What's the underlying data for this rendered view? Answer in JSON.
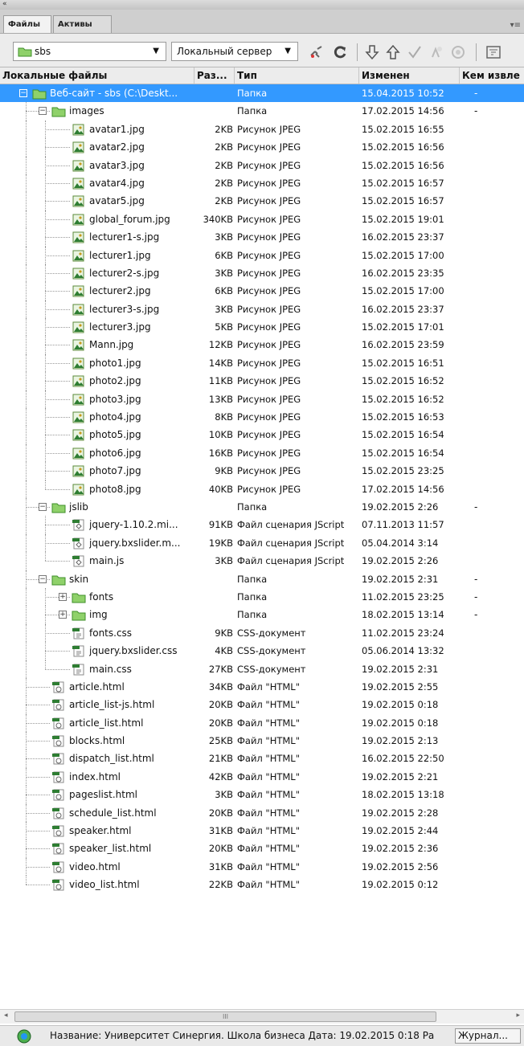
{
  "top": {
    "collapse_glyph": "«",
    "panel_menu_glyph": "▾≡"
  },
  "tabs": [
    {
      "label": "Файлы"
    },
    {
      "label": "Активы"
    }
  ],
  "toolbar": {
    "site_select": "sbs",
    "server_select": "Локальный сервер"
  },
  "icons": {
    "connect": "connect-icon",
    "refresh": "refresh-icon",
    "get": "get-files-icon",
    "put": "put-files-icon",
    "checkout": "check-out-icon",
    "checkin": "check-in-icon",
    "sync": "synchronize-icon",
    "expand": "expand-panel-icon"
  },
  "columns": {
    "name": "Локальные файлы",
    "size": "Раз...",
    "type": "Тип",
    "modified": "Изменен",
    "checked_out": "Кем извле"
  },
  "rows": [
    {
      "depth": 0,
      "kind": "folder",
      "expand": "-",
      "name": "Веб-сайт - sbs (C:\\Deskt...",
      "size": "",
      "type": "Папка",
      "modified": "15.04.2015 10:52",
      "co": "-",
      "selected": true
    },
    {
      "depth": 1,
      "kind": "folder",
      "expand": "-",
      "name": "images",
      "size": "",
      "type": "Папка",
      "modified": "17.02.2015 14:56",
      "co": "-"
    },
    {
      "depth": 2,
      "kind": "jpg",
      "name": "avatar1.jpg",
      "size": "2KB",
      "type": "Рисунок JPEG",
      "modified": "15.02.2015 16:55"
    },
    {
      "depth": 2,
      "kind": "jpg",
      "name": "avatar2.jpg",
      "size": "2KB",
      "type": "Рисунок JPEG",
      "modified": "15.02.2015 16:56"
    },
    {
      "depth": 2,
      "kind": "jpg",
      "name": "avatar3.jpg",
      "size": "2KB",
      "type": "Рисунок JPEG",
      "modified": "15.02.2015 16:56"
    },
    {
      "depth": 2,
      "kind": "jpg",
      "name": "avatar4.jpg",
      "size": "2KB",
      "type": "Рисунок JPEG",
      "modified": "15.02.2015 16:57"
    },
    {
      "depth": 2,
      "kind": "jpg",
      "name": "avatar5.jpg",
      "size": "2KB",
      "type": "Рисунок JPEG",
      "modified": "15.02.2015 16:57"
    },
    {
      "depth": 2,
      "kind": "jpg",
      "name": "global_forum.jpg",
      "size": "340KB",
      "type": "Рисунок JPEG",
      "modified": "15.02.2015 19:01"
    },
    {
      "depth": 2,
      "kind": "jpg",
      "name": "lecturer1-s.jpg",
      "size": "3KB",
      "type": "Рисунок JPEG",
      "modified": "16.02.2015 23:37"
    },
    {
      "depth": 2,
      "kind": "jpg",
      "name": "lecturer1.jpg",
      "size": "6KB",
      "type": "Рисунок JPEG",
      "modified": "15.02.2015 17:00"
    },
    {
      "depth": 2,
      "kind": "jpg",
      "name": "lecturer2-s.jpg",
      "size": "3KB",
      "type": "Рисунок JPEG",
      "modified": "16.02.2015 23:35"
    },
    {
      "depth": 2,
      "kind": "jpg",
      "name": "lecturer2.jpg",
      "size": "6KB",
      "type": "Рисунок JPEG",
      "modified": "15.02.2015 17:00"
    },
    {
      "depth": 2,
      "kind": "jpg",
      "name": "lecturer3-s.jpg",
      "size": "3KB",
      "type": "Рисунок JPEG",
      "modified": "16.02.2015 23:37"
    },
    {
      "depth": 2,
      "kind": "jpg",
      "name": "lecturer3.jpg",
      "size": "5KB",
      "type": "Рисунок JPEG",
      "modified": "15.02.2015 17:01"
    },
    {
      "depth": 2,
      "kind": "jpg",
      "name": "Mann.jpg",
      "size": "12KB",
      "type": "Рисунок JPEG",
      "modified": "16.02.2015 23:59"
    },
    {
      "depth": 2,
      "kind": "jpg",
      "name": "photo1.jpg",
      "size": "14KB",
      "type": "Рисунок JPEG",
      "modified": "15.02.2015 16:51"
    },
    {
      "depth": 2,
      "kind": "jpg",
      "name": "photo2.jpg",
      "size": "11KB",
      "type": "Рисунок JPEG",
      "modified": "15.02.2015 16:52"
    },
    {
      "depth": 2,
      "kind": "jpg",
      "name": "photo3.jpg",
      "size": "13KB",
      "type": "Рисунок JPEG",
      "modified": "15.02.2015 16:52"
    },
    {
      "depth": 2,
      "kind": "jpg",
      "name": "photo4.jpg",
      "size": "8KB",
      "type": "Рисунок JPEG",
      "modified": "15.02.2015 16:53"
    },
    {
      "depth": 2,
      "kind": "jpg",
      "name": "photo5.jpg",
      "size": "10KB",
      "type": "Рисунок JPEG",
      "modified": "15.02.2015 16:54"
    },
    {
      "depth": 2,
      "kind": "jpg",
      "name": "photo6.jpg",
      "size": "16KB",
      "type": "Рисунок JPEG",
      "modified": "15.02.2015 16:54"
    },
    {
      "depth": 2,
      "kind": "jpg",
      "name": "photo7.jpg",
      "size": "9KB",
      "type": "Рисунок JPEG",
      "modified": "15.02.2015 23:25"
    },
    {
      "depth": 2,
      "kind": "jpg",
      "name": "photo8.jpg",
      "size": "40KB",
      "type": "Рисунок JPEG",
      "modified": "17.02.2015 14:56"
    },
    {
      "depth": 1,
      "kind": "folder",
      "expand": "-",
      "name": "jslib",
      "size": "",
      "type": "Папка",
      "modified": "19.02.2015 2:26",
      "co": "-"
    },
    {
      "depth": 2,
      "kind": "js",
      "name": "jquery-1.10.2.mi...",
      "size": "91KB",
      "type": "Файл сценария JScript",
      "modified": "07.11.2013 11:57"
    },
    {
      "depth": 2,
      "kind": "js",
      "name": "jquery.bxslider.m...",
      "size": "19KB",
      "type": "Файл сценария JScript",
      "modified": "05.04.2014 3:14"
    },
    {
      "depth": 2,
      "kind": "js",
      "name": "main.js",
      "size": "3KB",
      "type": "Файл сценария JScript",
      "modified": "19.02.2015 2:26"
    },
    {
      "depth": 1,
      "kind": "folder",
      "expand": "-",
      "name": "skin",
      "size": "",
      "type": "Папка",
      "modified": "19.02.2015 2:31",
      "co": "-"
    },
    {
      "depth": 2,
      "kind": "folder",
      "expand": "+",
      "name": "fonts",
      "size": "",
      "type": "Папка",
      "modified": "11.02.2015 23:25",
      "co": "-"
    },
    {
      "depth": 2,
      "kind": "folder",
      "expand": "+",
      "name": "img",
      "size": "",
      "type": "Папка",
      "modified": "18.02.2015 13:14",
      "co": "-"
    },
    {
      "depth": 2,
      "kind": "css",
      "name": "fonts.css",
      "size": "9KB",
      "type": "CSS-документ",
      "modified": "11.02.2015 23:24"
    },
    {
      "depth": 2,
      "kind": "css",
      "name": "jquery.bxslider.css",
      "size": "4KB",
      "type": "CSS-документ",
      "modified": "05.06.2014 13:32"
    },
    {
      "depth": 2,
      "kind": "css",
      "name": "main.css",
      "size": "27KB",
      "type": "CSS-документ",
      "modified": "19.02.2015 2:31"
    },
    {
      "depth": 1,
      "kind": "html",
      "name": "article.html",
      "size": "34KB",
      "type": "Файл \"HTML\"",
      "modified": "19.02.2015 2:55"
    },
    {
      "depth": 1,
      "kind": "html",
      "name": "article_list-js.html",
      "size": "20KB",
      "type": "Файл \"HTML\"",
      "modified": "19.02.2015 0:18"
    },
    {
      "depth": 1,
      "kind": "html",
      "name": "article_list.html",
      "size": "20KB",
      "type": "Файл \"HTML\"",
      "modified": "19.02.2015 0:18"
    },
    {
      "depth": 1,
      "kind": "html",
      "name": "blocks.html",
      "size": "25KB",
      "type": "Файл \"HTML\"",
      "modified": "19.02.2015 2:13"
    },
    {
      "depth": 1,
      "kind": "html",
      "name": "dispatch_list.html",
      "size": "21KB",
      "type": "Файл \"HTML\"",
      "modified": "16.02.2015 22:50"
    },
    {
      "depth": 1,
      "kind": "html",
      "name": "index.html",
      "size": "42KB",
      "type": "Файл \"HTML\"",
      "modified": "19.02.2015 2:21"
    },
    {
      "depth": 1,
      "kind": "html",
      "name": "pageslist.html",
      "size": "3KB",
      "type": "Файл \"HTML\"",
      "modified": "18.02.2015 13:18"
    },
    {
      "depth": 1,
      "kind": "html",
      "name": "schedule_list.html",
      "size": "20KB",
      "type": "Файл \"HTML\"",
      "modified": "19.02.2015 2:28"
    },
    {
      "depth": 1,
      "kind": "html",
      "name": "speaker.html",
      "size": "31KB",
      "type": "Файл \"HTML\"",
      "modified": "19.02.2015 2:44"
    },
    {
      "depth": 1,
      "kind": "html",
      "name": "speaker_list.html",
      "size": "20KB",
      "type": "Файл \"HTML\"",
      "modified": "19.02.2015 2:36"
    },
    {
      "depth": 1,
      "kind": "html",
      "name": "video.html",
      "size": "31KB",
      "type": "Файл \"HTML\"",
      "modified": "19.02.2015 2:56"
    },
    {
      "depth": 1,
      "kind": "html",
      "name": "video_list.html",
      "size": "22KB",
      "type": "Файл \"HTML\"",
      "modified": "19.02.2015 0:12"
    }
  ],
  "scrollbar": {
    "thumb_grip": "III",
    "left": "◂",
    "right": "▸"
  },
  "status": {
    "text": "Название: Университет Синергия. Школа бизнеса  Дата: 19.02.2015 0:18  Ра",
    "log_button": "Журнал..."
  },
  "colors": {
    "selection": "#3399ff",
    "folder": "#e6c64a",
    "folder_border": "#b08a10",
    "icon_green": "#2e7d32"
  }
}
